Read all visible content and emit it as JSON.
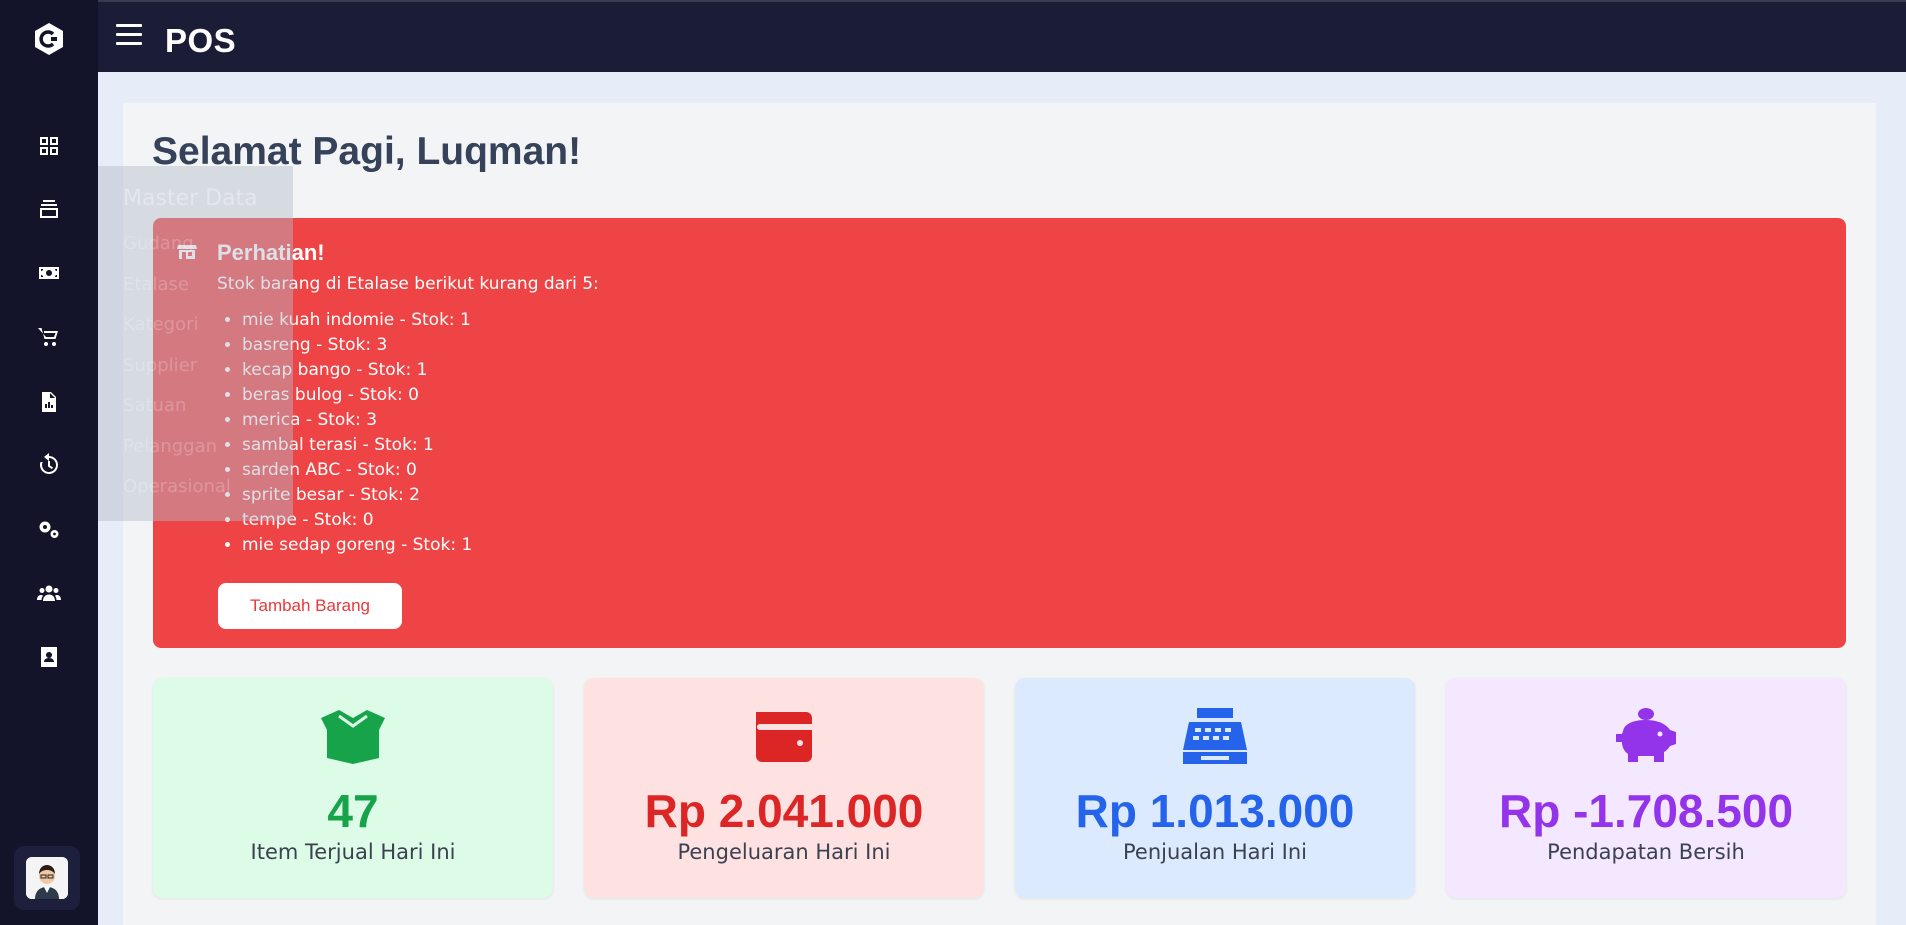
{
  "app": {
    "title": "POS"
  },
  "greeting": "Selamat Pagi, Luqman!",
  "overlay_menu": {
    "title": "Master Data",
    "items": [
      "Gudang",
      "Etalase",
      "Kategori",
      "Supplier",
      "Satuan",
      "Pelanggan",
      "Operasional"
    ]
  },
  "sidebar": {
    "icons": [
      "dashboard-icon",
      "layers-icon",
      "money-icon",
      "cart-icon",
      "report-icon",
      "history-icon",
      "settings-icon",
      "users-icon",
      "contact-icon"
    ]
  },
  "alert": {
    "title": "Perhatian!",
    "message": "Stok barang di Etalase berikut kurang dari 5:",
    "items": [
      "mie kuah indomie - Stok: 1",
      "basreng - Stok: 3",
      "kecap bango - Stok: 1",
      "beras bulog - Stok: 0",
      "merica - Stok: 3",
      "sambal terasi - Stok: 1",
      "sarden ABC - Stok: 0",
      "sprite besar - Stok: 2",
      "tempe - Stok: 0",
      "mie sedap goreng - Stok: 1"
    ],
    "button_label": "Tambah Barang"
  },
  "stats": [
    {
      "value": "47",
      "label": "Item Terjual Hari Ini",
      "color": "#16a34a",
      "bg": "#dcfce7",
      "icon": "box-icon"
    },
    {
      "value": "Rp 2.041.000",
      "label": "Pengeluaran Hari Ini",
      "color": "#dc2626",
      "bg": "#fee2e2",
      "icon": "wallet-icon"
    },
    {
      "value": "Rp 1.013.000",
      "label": "Penjualan Hari Ini",
      "color": "#2563eb",
      "bg": "#dbeafe",
      "icon": "cash-register-icon"
    },
    {
      "value": "Rp -1.708.500",
      "label": "Pendapatan Bersih",
      "color": "#9333ea",
      "bg": "#f3e8ff",
      "icon": "piggy-bank-icon"
    }
  ]
}
